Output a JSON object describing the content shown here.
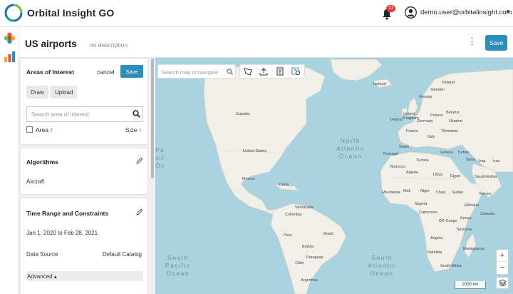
{
  "app": {
    "brand": "Orbital Insight GO",
    "notifications_count": "11",
    "user_email": "demo.user@orbitalinsight.com"
  },
  "page": {
    "title": "US airports",
    "description": "no description",
    "save_label": "Save"
  },
  "panel": {
    "aoi": {
      "title": "Areas of Interest",
      "cancel_label": "cancel",
      "save_label": "Save",
      "draw_label": "Draw",
      "upload_label": "Upload",
      "search_placeholder": "Search area of interest",
      "col_area": "Area ↑",
      "col_size": "Size ↑"
    },
    "algorithms": {
      "title": "Algorithms",
      "value": "Aircraft"
    },
    "time_range": {
      "title": "Time Range and Constraints",
      "dates": "Jan 1, 2020 to Feb 28, 2021",
      "data_source_label": "Data Source",
      "data_source_value": "Default Catalog",
      "advanced_label": "Advanced ▴"
    }
  },
  "map": {
    "search_placeholder": "Search map to navigate",
    "scale_label": "2000 km",
    "zoom_in": "+",
    "zoom_out": "−",
    "oceans": {
      "north_atlantic": "North\nAtlantic\nOcean",
      "south_pacific": "South\nPacific\nOcean",
      "south_atlantic": "South\nAtlantic\nOcean",
      "pacific_top": "Pa\ncif\nOc"
    },
    "labels": {
      "iceland": "Iceland",
      "norway": "Norway",
      "sweden": "Sweden",
      "finland": "Finland",
      "canada": "Canada",
      "united_kingdom": "United\nKingdom",
      "ireland": "Ireland",
      "poland": "Poland",
      "belarus": "Belarus",
      "ukraine": "Ukraine",
      "germany": "Germany",
      "france": "France",
      "romania": "Romania",
      "italy": "Italy",
      "spain": "Spain",
      "portugal": "Portugal",
      "greece": "Greece",
      "turkey": "Turkey",
      "united_states": "United States",
      "tunisia": "Tunisia",
      "syria": "Syria",
      "iraq": "Iraq",
      "iran": "Iran",
      "morocco": "Morocco",
      "algeria": "Algeria",
      "libya": "Libya",
      "egypt": "Egypt",
      "saudi_arabia": "Saudi Arabia",
      "mexico": "Mexico",
      "cuba": "Cuba",
      "mauritania": "Mauritania",
      "mali": "Mali",
      "niger": "Niger",
      "chad": "Chad",
      "sudan": "Sudan",
      "yemen": "Yemen",
      "nigeria": "Nigeria",
      "ethiopia": "Ethiopia",
      "cameroon": "Cameroon",
      "somalia": "Somalia",
      "venezuela": "Venezuela",
      "colombia": "Colombia",
      "dr_congo": "DR Congo",
      "kenya": "Kenya",
      "tanzania": "Tanzania",
      "peru": "Peru",
      "brazil": "Brazil",
      "angola": "Angola",
      "bolivia": "Bolivia",
      "namibia": "Namibia",
      "madagascar": "Madagascar",
      "paraguay": "Paraguay",
      "chile": "Chile",
      "south_africa": "South Africa",
      "argentina": "Argentina"
    }
  },
  "colors": {
    "accent": "#2b8fbe",
    "ocean": "#aad3df",
    "land": "#f2efe9",
    "badge": "#e53935"
  },
  "icons": {
    "logo": "orbital-ring-logo",
    "bell": "bell-icon",
    "avatar": "user-avatar-icon"
  }
}
